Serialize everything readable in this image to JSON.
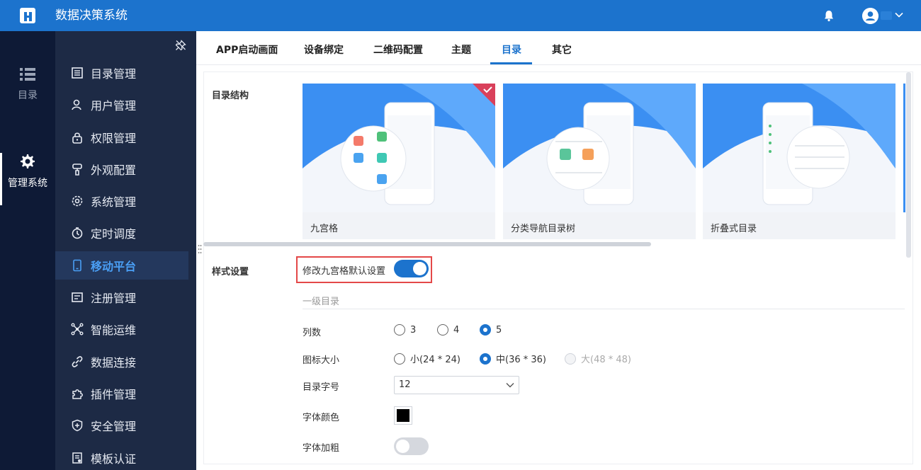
{
  "app": {
    "title": "数据决策系统"
  },
  "header": {
    "icons": [
      "logo-icon",
      "bell-icon",
      "avatar-icon",
      "chevron-down-icon"
    ]
  },
  "rail": [
    {
      "label": "目录",
      "icon": "list-icon",
      "active": false
    },
    {
      "label": "管理系统",
      "icon": "gear-icon",
      "active": true
    }
  ],
  "menu": [
    {
      "label": "目录管理",
      "icon": "catalog-icon"
    },
    {
      "label": "用户管理",
      "icon": "user-icon"
    },
    {
      "label": "权限管理",
      "icon": "lock-icon"
    },
    {
      "label": "外观配置",
      "icon": "paint-brush-icon"
    },
    {
      "label": "系统管理",
      "icon": "settings-icon"
    },
    {
      "label": "定时调度",
      "icon": "stopwatch-icon"
    },
    {
      "label": "移动平台",
      "icon": "mobile-icon",
      "active": true
    },
    {
      "label": "注册管理",
      "icon": "register-icon"
    },
    {
      "label": "智能运维",
      "icon": "network-icon"
    },
    {
      "label": "数据连接",
      "icon": "link-icon"
    },
    {
      "label": "插件管理",
      "icon": "puzzle-icon"
    },
    {
      "label": "安全管理",
      "icon": "shield-icon"
    },
    {
      "label": "模板认证",
      "icon": "certificate-icon"
    }
  ],
  "tabs": [
    {
      "label": "APP启动画面"
    },
    {
      "label": "设备绑定"
    },
    {
      "label": "二维码配置"
    },
    {
      "label": "主题"
    },
    {
      "label": "目录",
      "active": true
    },
    {
      "label": "其它"
    }
  ],
  "catalog_structure": {
    "label": "目录结构",
    "cards": [
      {
        "caption": "九宫格",
        "selected": true
      },
      {
        "caption": "分类导航目录树",
        "selected": false
      },
      {
        "caption": "折叠式目录",
        "selected": false
      }
    ]
  },
  "style_settings": {
    "label": "样式设置",
    "toggle_label": "修改九宫格默认设置",
    "toggle_on": true,
    "subhead": "一级目录",
    "columns": {
      "label": "列数",
      "options": [
        "3",
        "4",
        "5"
      ],
      "selected": "5"
    },
    "icon_size": {
      "label": "图标大小",
      "options": [
        "小(24 * 24)",
        "中(36 * 36)",
        "大(48 * 48)"
      ],
      "selected": "中(36 * 36)",
      "disabled": [
        "大(48 * 48)"
      ]
    },
    "font_size": {
      "label": "目录字号",
      "value": "12"
    },
    "font_color": {
      "label": "字体颜色",
      "value": "#000000"
    },
    "font_bold": {
      "label": "字体加粗",
      "on": false
    }
  },
  "colors": {
    "primary": "#1c73cd",
    "rail_bg": "#0e1a36",
    "menu_bg": "#1d2a45",
    "highlight": "#e44848"
  }
}
